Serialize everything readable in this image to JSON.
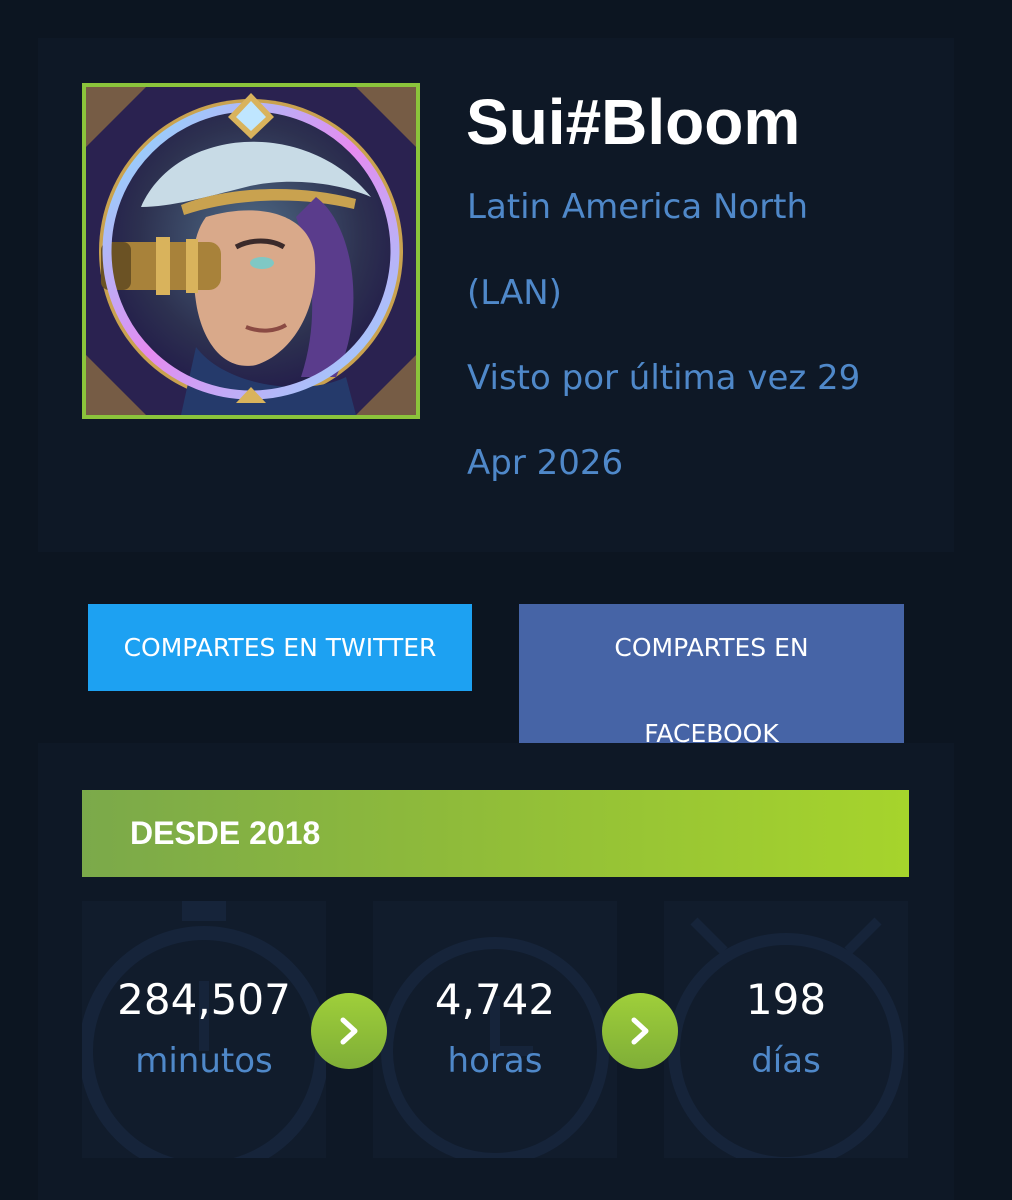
{
  "profile": {
    "name": "Sui#Bloom",
    "region_line1": "Latin America North",
    "region_line2": "(LAN)",
    "last_seen_line1": "Visto por última vez 29",
    "last_seen_line2": "Apr 2026",
    "avatar_icon": "champion-portrait-icon"
  },
  "share": {
    "twitter_label": "COMPARTES EN TWITTER",
    "facebook_line1": "COMPARTES EN",
    "facebook_line2": "FACEBOOK",
    "twitter_color": "#1da1f2",
    "facebook_color": "#4664a6"
  },
  "stats": {
    "since_label": "DESDE 2018",
    "accent_color": "#9fcf3a",
    "items": [
      {
        "value": "284,507",
        "unit": "minutos"
      },
      {
        "value": "4,742",
        "unit": "horas"
      },
      {
        "value": "198",
        "unit": "días"
      }
    ],
    "arrow_icon": "chevron-right-icon"
  }
}
